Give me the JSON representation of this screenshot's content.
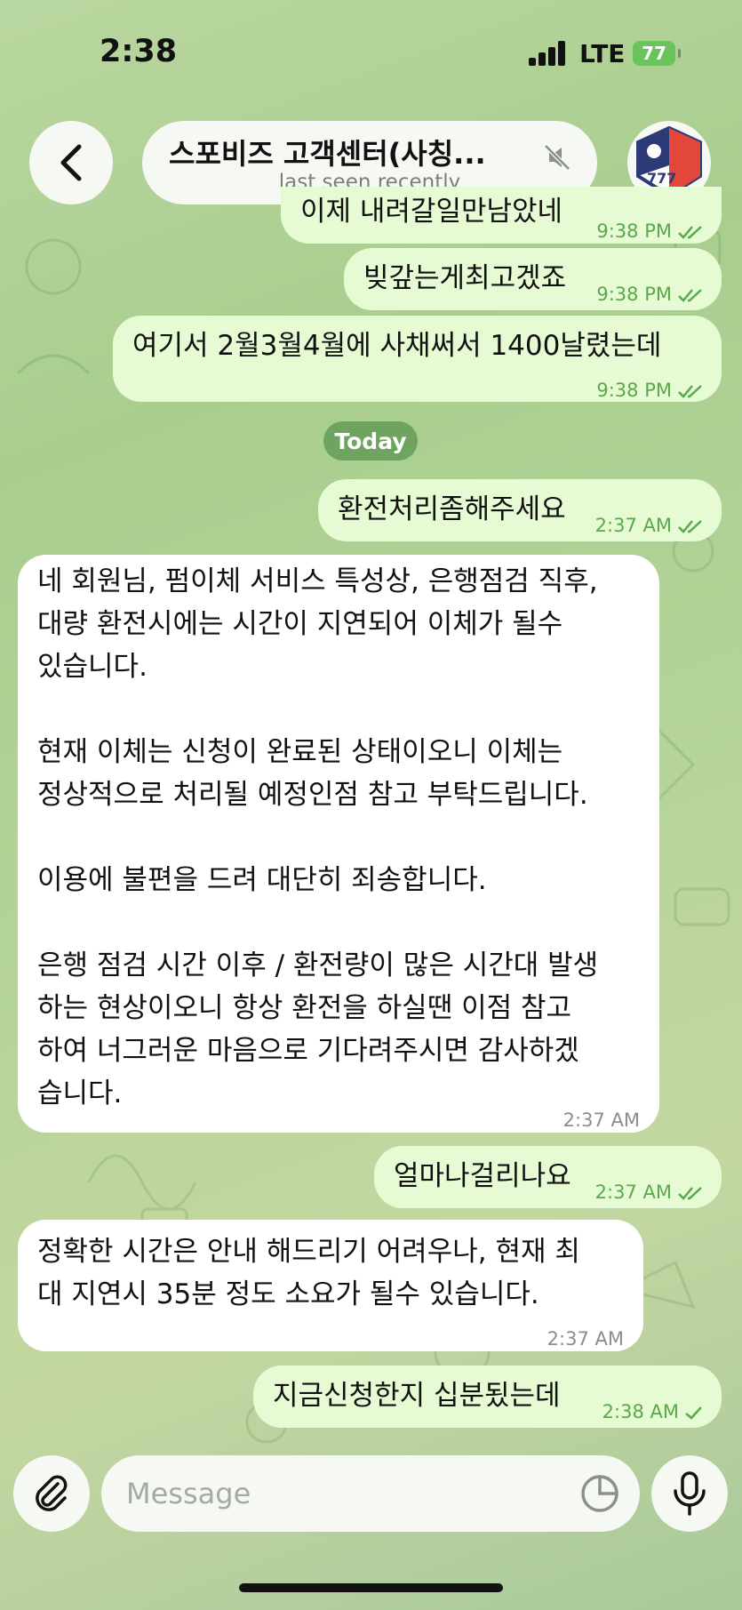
{
  "status_bar": {
    "time": "2:38",
    "network": "LTE",
    "battery": "77"
  },
  "header": {
    "title": "스포비즈 고객센터(사칭...",
    "subtitle": "last seen recently"
  },
  "messages": [
    {
      "text": "이제 내려갈일만남았네",
      "time": "9:38 PM",
      "dir": "out",
      "status": "read"
    },
    {
      "text": "빚갚는게최고겠죠",
      "time": "9:38 PM",
      "dir": "out",
      "status": "read"
    },
    {
      "text": "여기서 2월3월4월에 사채써서 1400날렸는데",
      "time": "9:38 PM",
      "dir": "out",
      "status": "read"
    },
    {
      "text": "환전처리좀해주세요",
      "time": "2:37 AM",
      "dir": "out",
      "status": "read"
    },
    {
      "text": "네 회원님, 펌이체 서비스 특성상, 은행점검 직후,\n대량 환전시에는 시간이 지연되어 이체가 될수\n있습니다.\n\n현재 이체는 신청이 완료된 상태이오니 이체는\n정상적으로 처리될 예정인점 참고 부탁드립니다.\n\n이용에 불편을 드려 대단히 죄송합니다.\n\n은행 점검 시간 이후 / 환전량이 많은 시간대 발생\n하는 현상이오니 항상 환전을 하실땐 이점 참고\n하여 너그러운 마음으로 기다려주시면 감사하겠\n습니다.",
      "time": "2:37 AM",
      "dir": "in"
    },
    {
      "text": "얼마나걸리나요",
      "time": "2:37 AM",
      "dir": "out",
      "status": "read"
    },
    {
      "text": "정확한 시간은 안내 해드리기 어려우나, 현재 최\n대 지연시 35분 정도 소요가 될수 있습니다.",
      "time": "2:37 AM",
      "dir": "in"
    },
    {
      "text": "지금신청한지 십분됬는데",
      "time": "2:38 AM",
      "dir": "out",
      "status": "sent"
    }
  ],
  "date_separator": "Today",
  "composer": {
    "placeholder": "Message"
  },
  "colors": {
    "outgoing_bubble": "#e6fbd3",
    "incoming_bubble": "#ffffff",
    "check": "#5aa84c"
  }
}
